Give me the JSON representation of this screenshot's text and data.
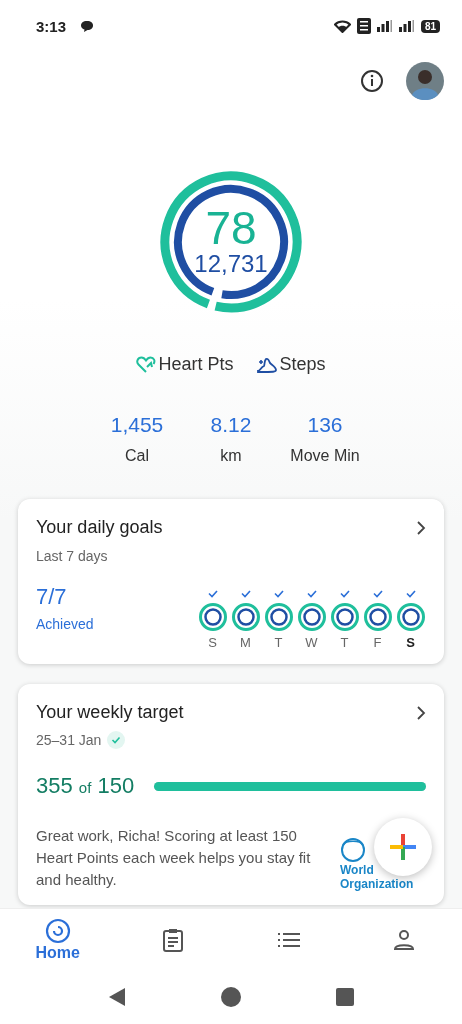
{
  "status_bar": {
    "time": "3:13",
    "battery": "81"
  },
  "rings": {
    "heart_points": {
      "value": "78",
      "level": 0.98
    },
    "steps": {
      "value": "12,731",
      "level": 0.97
    }
  },
  "legend": [
    {
      "kind": "heart",
      "label": "Heart Pts"
    },
    {
      "kind": "steps",
      "label": "Steps"
    }
  ],
  "stats": [
    {
      "value": "1,455",
      "label": "Cal"
    },
    {
      "value": "8.12",
      "label": "km"
    },
    {
      "value": "136",
      "label": "Move Min"
    }
  ],
  "daily_goals": {
    "title": "Your daily goals",
    "subtitle": "Last 7 days",
    "count": "7/7",
    "count_label": "Achieved",
    "days": [
      {
        "label": "S",
        "checked": true,
        "selected": false
      },
      {
        "label": "M",
        "checked": true,
        "selected": false
      },
      {
        "label": "T",
        "checked": true,
        "selected": false
      },
      {
        "label": "W",
        "checked": true,
        "selected": false
      },
      {
        "label": "T",
        "checked": true,
        "selected": false
      },
      {
        "label": "F",
        "checked": true,
        "selected": false
      },
      {
        "label": "S",
        "checked": true,
        "selected": true
      }
    ]
  },
  "weekly_target": {
    "title": "Your weekly target",
    "dates": "25–31 Jan",
    "achieved": true,
    "score": "355",
    "of": "of",
    "target": "150",
    "level": 1,
    "message": "Great work, Richa! Scoring at least 150 Heart Points each week helps you stay fit and healthy.",
    "logo_lines": [
      "World",
      "Organization"
    ]
  },
  "bottom_nav": [
    {
      "kind": "home",
      "label": "Home",
      "selected": true
    },
    {
      "kind": "journal",
      "selected": false
    },
    {
      "kind": "browse",
      "selected": false
    },
    {
      "kind": "profile",
      "selected": false
    }
  ]
}
